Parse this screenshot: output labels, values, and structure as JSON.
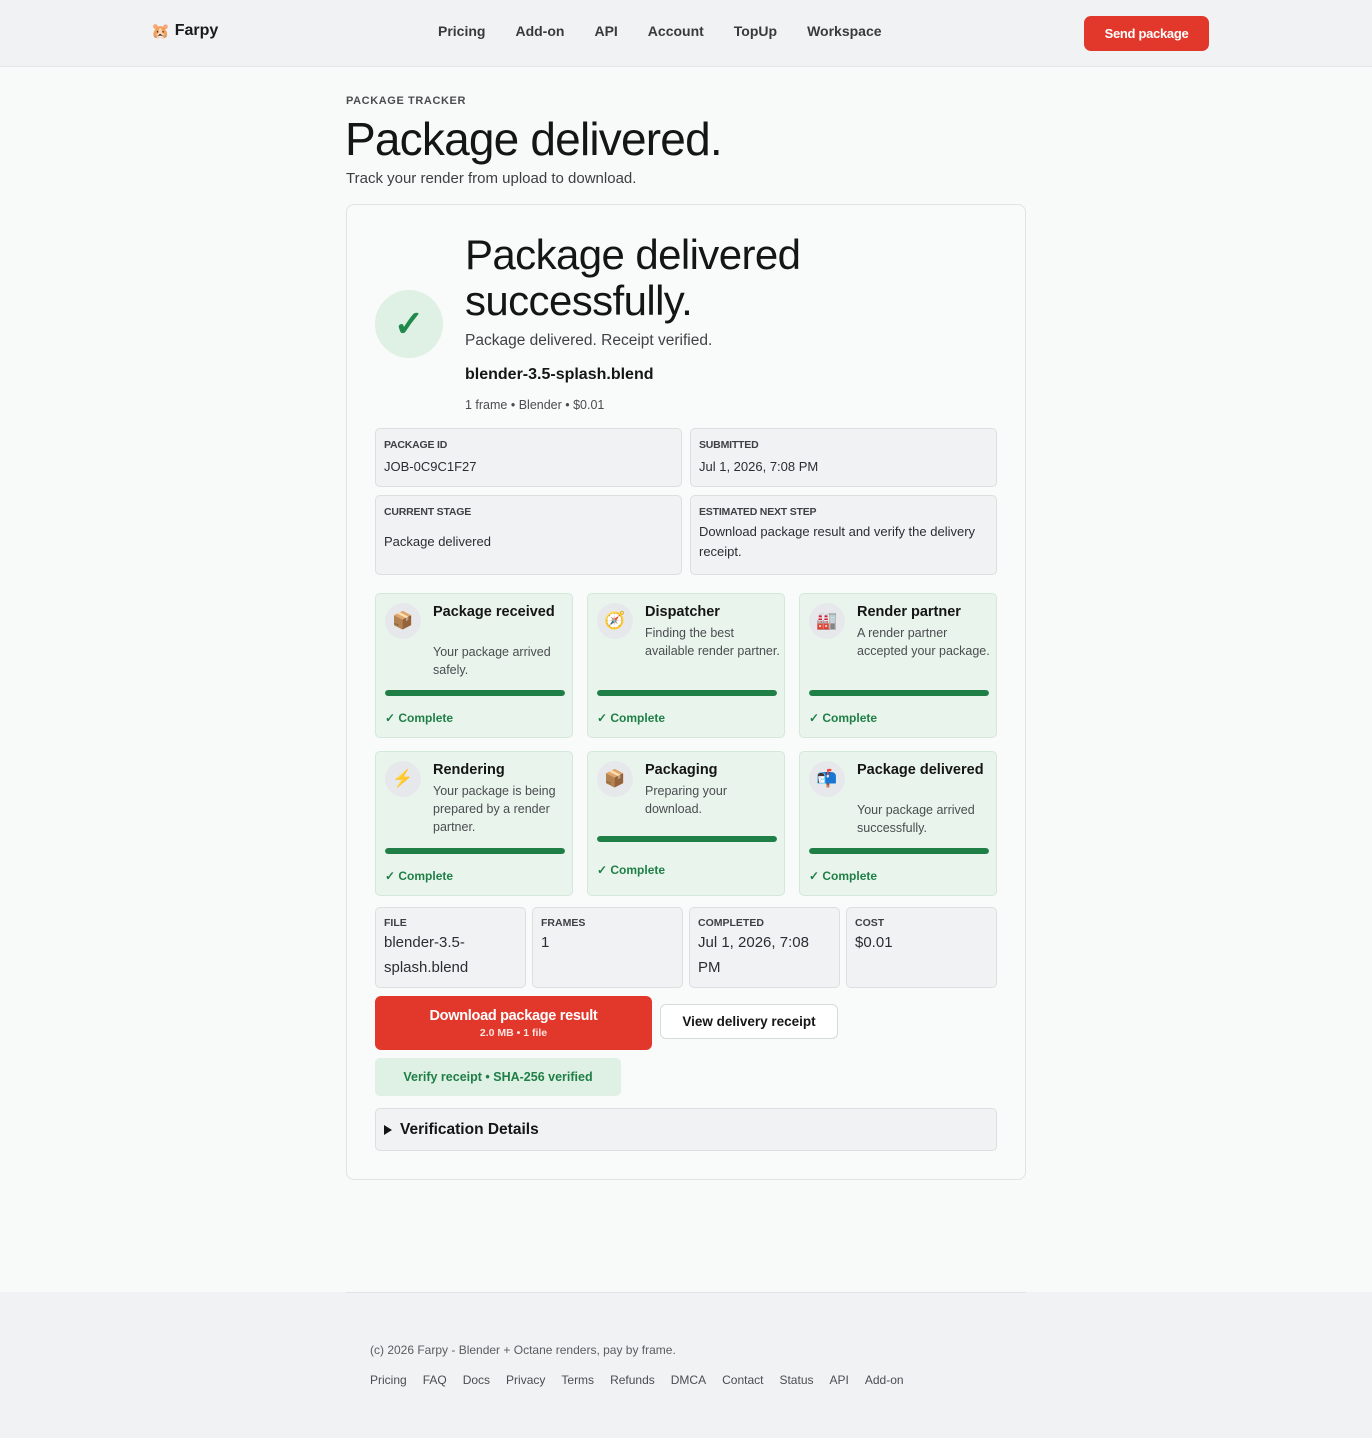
{
  "header": {
    "brand_icon": "🐹",
    "brand_name": "Farpy",
    "nav": [
      "Pricing",
      "Add-on",
      "API",
      "Account",
      "TopUp",
      "Workspace"
    ],
    "cta_label": "Send package"
  },
  "page": {
    "eyebrow": "PACKAGE TRACKER",
    "title": "Package delivered.",
    "subtitle": "Track your render from upload to download."
  },
  "hero": {
    "check_glyph": "✓",
    "title": "Package delivered successfully.",
    "subtitle": "Package delivered. Receipt verified.",
    "file_name": "blender-3.5-splash.blend",
    "meta": "1 frame • Blender • $0.01"
  },
  "info": {
    "package_id_label": "PACKAGE ID",
    "package_id_value": "JOB-0C9C1F27",
    "submitted_label": "SUBMITTED",
    "submitted_value": "Jul 1, 2026, 7:08 PM",
    "stage_label": "CURRENT STAGE",
    "stage_value": "Package delivered",
    "next_label": "ESTIMATED NEXT STEP",
    "next_value": "Download package result and verify the delivery receipt."
  },
  "stages": [
    {
      "icon": "📦",
      "icon_name": "package-icon",
      "title": "Package received",
      "desc": "Your package arrived safely.",
      "status": "✓ Complete",
      "progress": 1.0
    },
    {
      "icon": "🧭",
      "icon_name": "compass-icon",
      "title": "Dispatcher",
      "desc": "Finding the best available render partner.",
      "status": "✓ Complete",
      "progress": 1.0
    },
    {
      "icon": "🏭",
      "icon_name": "factory-icon",
      "title": "Render partner",
      "desc": "A render partner accepted your package.",
      "status": "✓ Complete",
      "progress": 1.0
    },
    {
      "icon": "⚡",
      "icon_name": "lightning-icon",
      "title": "Rendering",
      "desc": "Your package is being prepared by a render partner.",
      "status": "✓ Complete",
      "progress": 1.0
    },
    {
      "icon": "📦",
      "icon_name": "package-icon",
      "title": "Packaging",
      "desc": "Preparing your download.",
      "status": "✓ Complete",
      "progress": 1.0
    },
    {
      "icon": "📬",
      "icon_name": "mailbox-icon",
      "title": "Package delivered",
      "desc": "Your package arrived successfully.",
      "status": "✓ Complete",
      "progress": 1.0
    }
  ],
  "summary": {
    "file_label": "FILE",
    "file_value": "blender-3.5-splash.blend",
    "frames_label": "FRAMES",
    "frames_value": "1",
    "completed_label": "COMPLETED",
    "completed_value": "Jul 1, 2026, 7:08 PM",
    "cost_label": "COST",
    "cost_value": "$0.01"
  },
  "actions": {
    "download_label": "Download package result",
    "download_sub": "2.0 MB • 1 file",
    "receipt_label": "View delivery receipt",
    "verify_label": "Verify receipt • SHA-256 verified",
    "details_label": "Verification Details"
  },
  "footer": {
    "copyright": "(c) 2026 Farpy - Blender + Octane renders, pay by frame.",
    "links": [
      "Pricing",
      "FAQ",
      "Docs",
      "Privacy",
      "Terms",
      "Refunds",
      "DMCA",
      "Contact",
      "Status",
      "API",
      "Add-on"
    ]
  }
}
